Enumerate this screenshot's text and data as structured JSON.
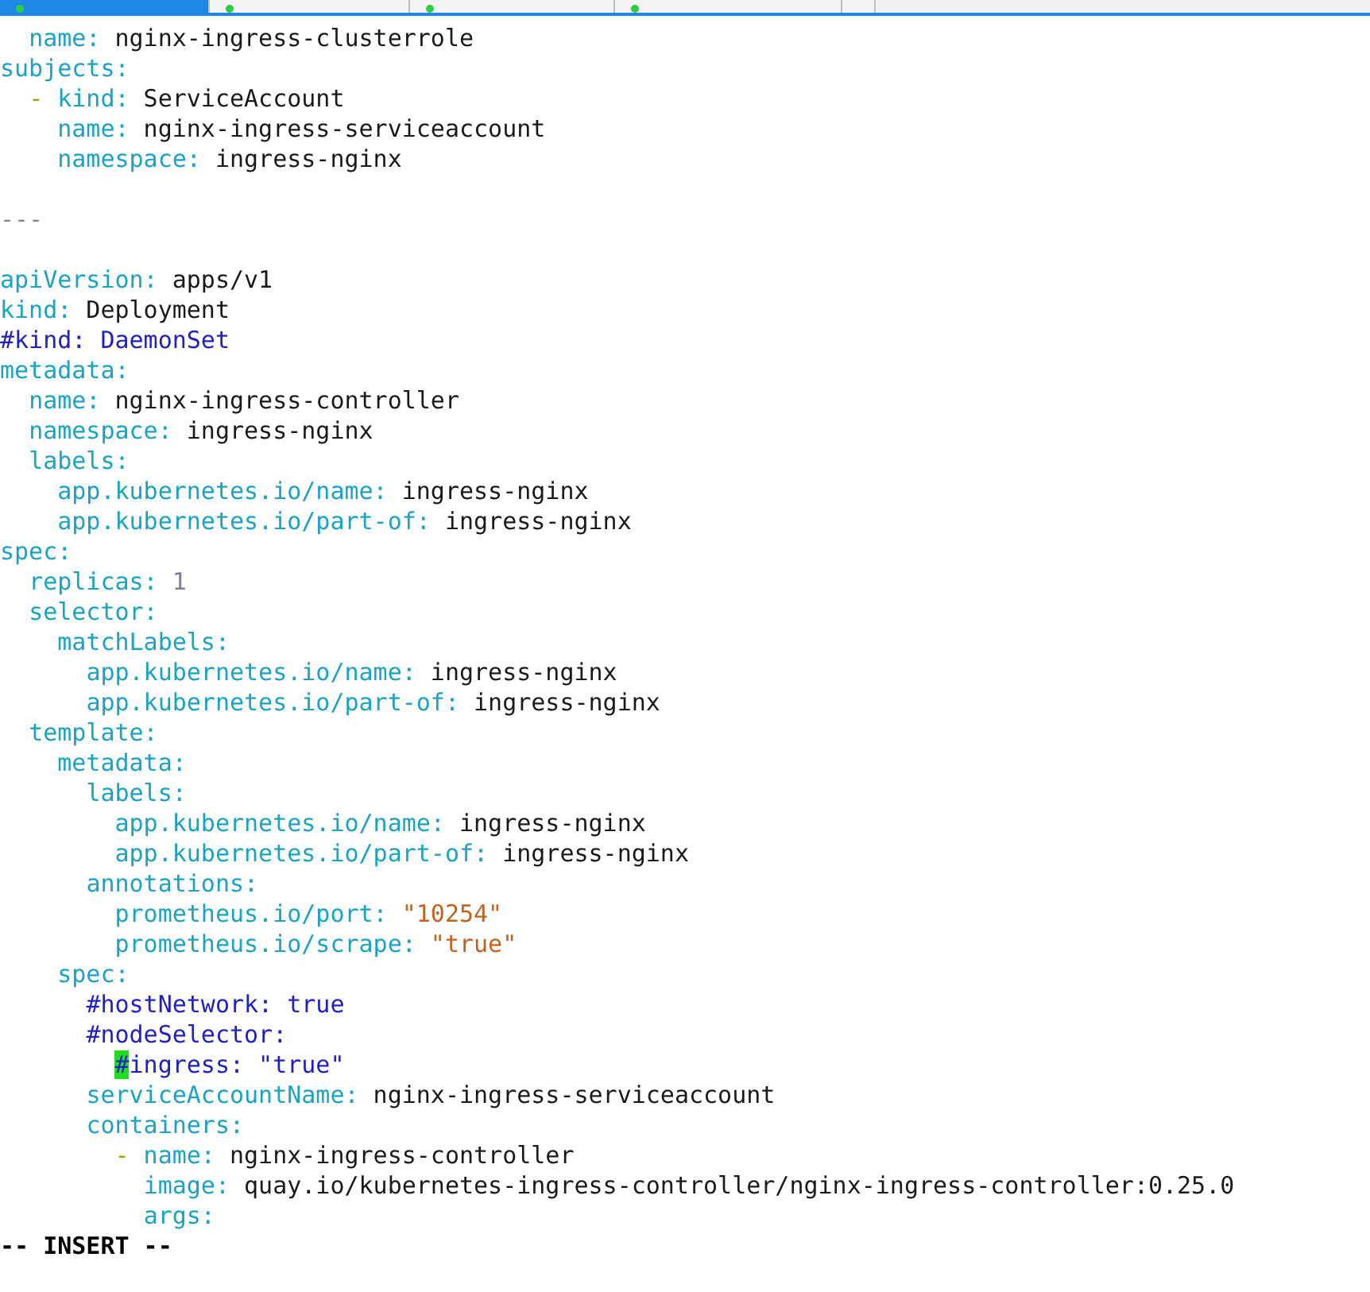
{
  "tabs": [
    {
      "selected": true
    },
    {
      "selected": false
    },
    {
      "selected": false
    },
    {
      "selected": false
    }
  ],
  "editor": {
    "lines": [
      {
        "kind": "code",
        "tokens": [
          {
            "text": "  name:",
            "kind": "key"
          },
          {
            "text": " nginx-ingress-clusterrole",
            "kind": "value"
          }
        ]
      },
      {
        "kind": "code",
        "tokens": [
          {
            "text": "subjects:",
            "kind": "key"
          }
        ]
      },
      {
        "kind": "code",
        "tokens": [
          {
            "text": "  -",
            "kind": "dash"
          },
          {
            "text": " kind:",
            "kind": "key"
          },
          {
            "text": " ServiceAccount",
            "kind": "value"
          }
        ]
      },
      {
        "kind": "code",
        "tokens": [
          {
            "text": "    name:",
            "kind": "key"
          },
          {
            "text": " nginx-ingress-serviceaccount",
            "kind": "value"
          }
        ]
      },
      {
        "kind": "code",
        "tokens": [
          {
            "text": "    namespace:",
            "kind": "key"
          },
          {
            "text": " ingress-nginx",
            "kind": "value"
          }
        ]
      },
      {
        "kind": "separator",
        "text": "---"
      },
      {
        "kind": "code",
        "tokens": [
          {
            "text": "apiVersion:",
            "kind": "key"
          },
          {
            "text": " apps/v1",
            "kind": "value"
          }
        ]
      },
      {
        "kind": "code",
        "tokens": [
          {
            "text": "kind:",
            "kind": "key"
          },
          {
            "text": " Deployment",
            "kind": "value"
          }
        ]
      },
      {
        "kind": "code",
        "tokens": [
          {
            "text": "#kind: DaemonSet",
            "kind": "comment"
          }
        ]
      },
      {
        "kind": "code",
        "tokens": [
          {
            "text": "metadata:",
            "kind": "key"
          }
        ]
      },
      {
        "kind": "code",
        "tokens": [
          {
            "text": "  name:",
            "kind": "key"
          },
          {
            "text": " nginx-ingress-controller",
            "kind": "value"
          }
        ]
      },
      {
        "kind": "code",
        "tokens": [
          {
            "text": "  namespace:",
            "kind": "key"
          },
          {
            "text": " ingress-nginx",
            "kind": "value"
          }
        ]
      },
      {
        "kind": "code",
        "tokens": [
          {
            "text": "  labels:",
            "kind": "key"
          }
        ]
      },
      {
        "kind": "code",
        "tokens": [
          {
            "text": "    app.kubernetes.io/name:",
            "kind": "key"
          },
          {
            "text": " ingress-nginx",
            "kind": "value"
          }
        ]
      },
      {
        "kind": "code",
        "tokens": [
          {
            "text": "    app.kubernetes.io/part-of:",
            "kind": "key"
          },
          {
            "text": " ingress-nginx",
            "kind": "value"
          }
        ]
      },
      {
        "kind": "code",
        "tokens": [
          {
            "text": "spec:",
            "kind": "key"
          }
        ]
      },
      {
        "kind": "code",
        "tokens": [
          {
            "text": "  replicas:",
            "kind": "key"
          },
          {
            "text": " 1",
            "kind": "number"
          }
        ]
      },
      {
        "kind": "code",
        "tokens": [
          {
            "text": "  selector:",
            "kind": "key"
          }
        ]
      },
      {
        "kind": "code",
        "tokens": [
          {
            "text": "    matchLabels:",
            "kind": "key"
          }
        ]
      },
      {
        "kind": "code",
        "tokens": [
          {
            "text": "      app.kubernetes.io/name:",
            "kind": "key"
          },
          {
            "text": " ingress-nginx",
            "kind": "value"
          }
        ]
      },
      {
        "kind": "code",
        "tokens": [
          {
            "text": "      app.kubernetes.io/part-of:",
            "kind": "key"
          },
          {
            "text": " ingress-nginx",
            "kind": "value"
          }
        ]
      },
      {
        "kind": "code",
        "tokens": [
          {
            "text": "  template:",
            "kind": "key"
          }
        ]
      },
      {
        "kind": "code",
        "tokens": [
          {
            "text": "    metadata:",
            "kind": "key"
          }
        ]
      },
      {
        "kind": "code",
        "tokens": [
          {
            "text": "      labels:",
            "kind": "key"
          }
        ]
      },
      {
        "kind": "code",
        "tokens": [
          {
            "text": "        app.kubernetes.io/name:",
            "kind": "key"
          },
          {
            "text": " ingress-nginx",
            "kind": "value"
          }
        ]
      },
      {
        "kind": "code",
        "tokens": [
          {
            "text": "        app.kubernetes.io/part-of:",
            "kind": "key"
          },
          {
            "text": " ingress-nginx",
            "kind": "value"
          }
        ]
      },
      {
        "kind": "code",
        "tokens": [
          {
            "text": "      annotations:",
            "kind": "key"
          }
        ]
      },
      {
        "kind": "code",
        "tokens": [
          {
            "text": "        prometheus.io/port:",
            "kind": "key"
          },
          {
            "text": " \"10254\"",
            "kind": "string"
          }
        ]
      },
      {
        "kind": "code",
        "tokens": [
          {
            "text": "        prometheus.io/scrape:",
            "kind": "key"
          },
          {
            "text": " \"true\"",
            "kind": "string"
          }
        ]
      },
      {
        "kind": "code",
        "tokens": [
          {
            "text": "    spec:",
            "kind": "key"
          }
        ]
      },
      {
        "kind": "code",
        "tokens": [
          {
            "text": "      #hostNetwork: true",
            "kind": "comment"
          }
        ]
      },
      {
        "kind": "code",
        "tokens": [
          {
            "text": "      #nodeSelector:",
            "kind": "comment"
          }
        ]
      },
      {
        "kind": "code",
        "tokens": [
          {
            "text": "        #",
            "kind": "cursor"
          },
          {
            "text": "ingress: \"true\"",
            "kind": "comment"
          }
        ]
      },
      {
        "kind": "code",
        "tokens": [
          {
            "text": "      serviceAccountName:",
            "kind": "key"
          },
          {
            "text": " nginx-ingress-serviceaccount",
            "kind": "value"
          }
        ]
      },
      {
        "kind": "code",
        "tokens": [
          {
            "text": "      containers:",
            "kind": "key"
          }
        ]
      },
      {
        "kind": "code",
        "tokens": [
          {
            "text": "        -",
            "kind": "dash"
          },
          {
            "text": " name:",
            "kind": "key"
          },
          {
            "text": " nginx-ingress-controller",
            "kind": "value"
          }
        ]
      },
      {
        "kind": "code",
        "tokens": [
          {
            "text": "          image:",
            "kind": "key"
          },
          {
            "text": " quay.io/kubernetes-ingress-controller/nginx-ingress-controller:0.25.0",
            "kind": "value"
          }
        ]
      },
      {
        "kind": "code",
        "tokens": [
          {
            "text": "          args:",
            "kind": "key"
          }
        ]
      }
    ],
    "mode": "-- INSERT --"
  }
}
